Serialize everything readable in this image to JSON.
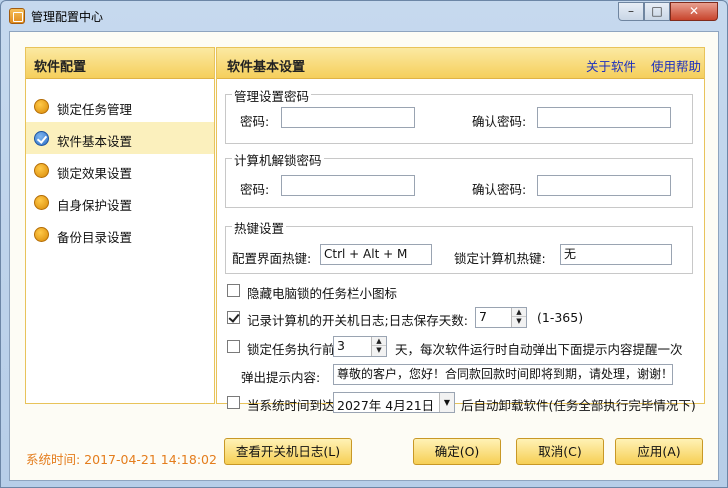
{
  "window": {
    "title": "管理配置中心",
    "min": "–",
    "max": "□",
    "close": "✕"
  },
  "sidebar": {
    "header": "软件配置",
    "items": [
      {
        "label": "锁定任务管理",
        "icon": "orange-dot-icon"
      },
      {
        "label": "软件基本设置",
        "icon": "blue-check-icon"
      },
      {
        "label": "锁定效果设置",
        "icon": "orange-dot-icon"
      },
      {
        "label": "自身保护设置",
        "icon": "orange-dot-icon"
      },
      {
        "label": "备份目录设置",
        "icon": "orange-dot-icon"
      }
    ],
    "selected_index": 1
  },
  "panel": {
    "title": "软件基本设置",
    "about_link": "关于软件",
    "help_link": "使用帮助"
  },
  "admin_pwd": {
    "legend": "管理设置密码",
    "password_label": "密码:",
    "password_value": "",
    "confirm_label": "确认密码:",
    "confirm_value": ""
  },
  "unlock_pwd": {
    "legend": "计算机解锁密码",
    "password_label": "密码:",
    "password_value": "",
    "confirm_label": "确认密码:",
    "confirm_value": ""
  },
  "hotkeys": {
    "legend": "热键设置",
    "config_label": "配置界面热键:",
    "config_value": "Ctrl + Alt + M",
    "lock_label": "锁定计算机热键:",
    "lock_value": "无"
  },
  "options": {
    "hide_tray": {
      "label": "隐藏电脑锁的任务栏小图标",
      "checked": false
    },
    "log_power": {
      "label": "记录计算机的开关机日志;日志保存天数:",
      "checked": true,
      "days": "7",
      "range": "(1-365)"
    },
    "lock_before": {
      "label": "锁定任务执行前",
      "checked": false,
      "days": "3",
      "suffix": "天，每次软件运行时自动弹出下面提示内容提醒一次"
    },
    "popup": {
      "label": "弹出提示内容:",
      "value": "尊敬的客户，您好！合同款回款时间即将到期，请处理，谢谢！"
    },
    "uninstall": {
      "label": "当系统时间到达",
      "checked": false,
      "date": "2027年  4月21日",
      "suffix": "后自动卸载软件(任务全部执行完毕情况下)"
    }
  },
  "footer": {
    "system_time": "系统时间: 2017-04-21 14:18:02",
    "view_log": "查看开关机日志(L)",
    "ok": "确定(O)",
    "cancel": "取消(C)",
    "apply": "应用(A)"
  }
}
